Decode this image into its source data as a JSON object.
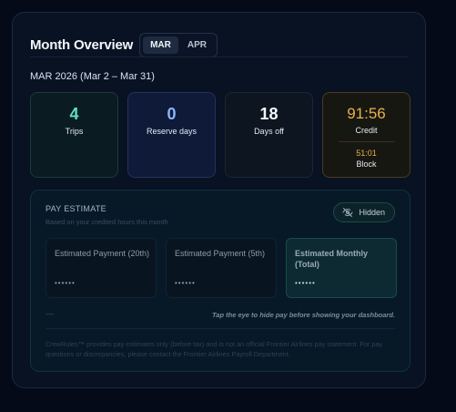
{
  "header": {
    "title": "Month Overview",
    "months": [
      {
        "label": "MAR",
        "active": true
      },
      {
        "label": "APR",
        "active": false
      }
    ]
  },
  "period": "MAR 2026 (Mar 2 – Mar 31)",
  "stats": {
    "trips": {
      "value": "4",
      "label": "Trips"
    },
    "reserve": {
      "value": "0",
      "label": "Reserve days"
    },
    "off": {
      "value": "18",
      "label": "Days off"
    },
    "credit": {
      "value": "91:56",
      "label": "Credit",
      "block_value": "51:01",
      "block_label": "Block"
    }
  },
  "pay": {
    "title": "PAY ESTIMATE",
    "subtitle": "Based on your credited hours this month",
    "toggle_label": "Hidden",
    "toggle_icon": "eye-off-icon",
    "estimates": [
      {
        "name": "Estimated Payment (20th)",
        "value": "••••••"
      },
      {
        "name": "Estimated Payment (5th)",
        "value": "••••••"
      },
      {
        "name": "Estimated Monthly (Total)",
        "value": "••••••"
      }
    ],
    "dash": "—",
    "hint": "Tap the eye to hide pay before showing your dashboard.",
    "disclaimer": "CrewRules™ provides pay estimates only (before tax) and is not an official Frontier Airlines pay statement. For pay questions or discrepancies, please contact the Frontier Airlines Payroll Department."
  },
  "colors": {
    "background": "#040a17",
    "card": "#081223",
    "trips_accent": "#5fe0c4",
    "reserve_accent": "#8fb4ff",
    "credit_accent": "#e6b24a"
  }
}
